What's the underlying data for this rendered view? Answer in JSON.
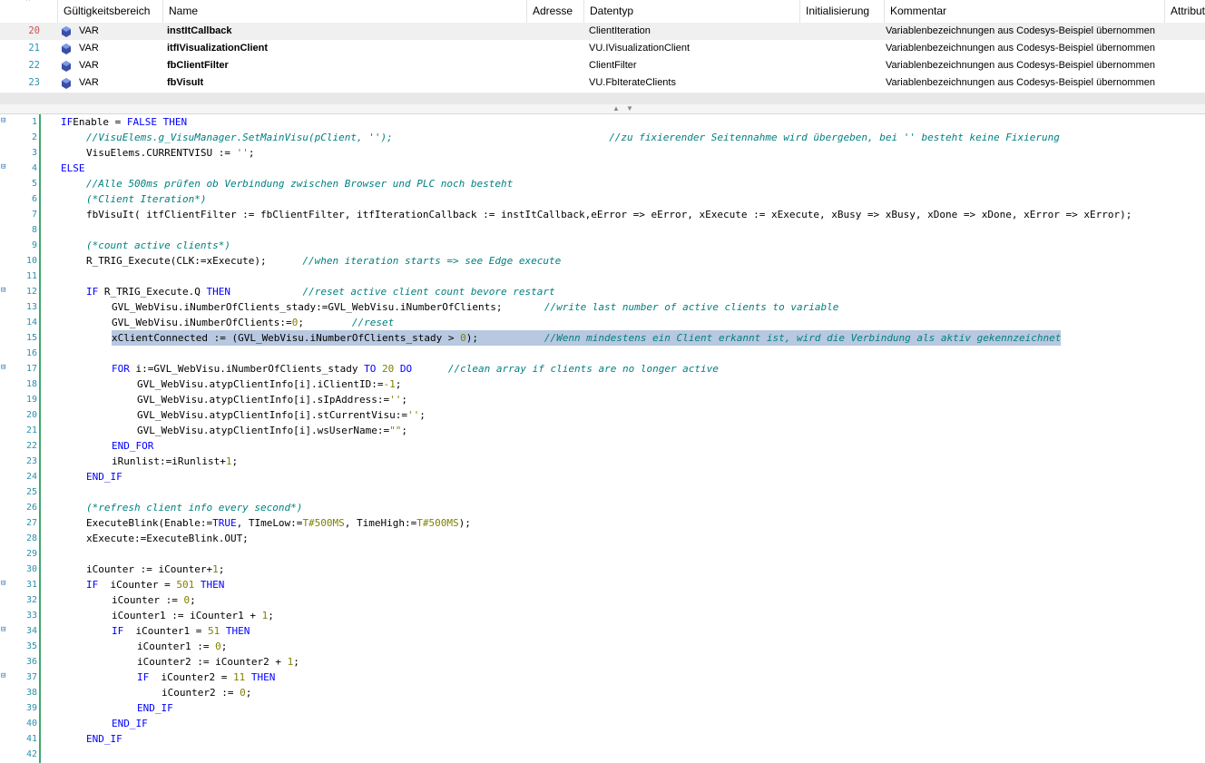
{
  "declaration": {
    "columns": [
      "Gültigkeitsbereich",
      "Name",
      "Adresse",
      "Datentyp",
      "Initialisierung",
      "Kommentar",
      "Attribut"
    ],
    "rows": [
      {
        "num": "20",
        "scope": "VAR",
        "name": "instItCallback",
        "address": "",
        "type": "ClientIteration",
        "init": "",
        "comment": "Variablenbezeichnungen aus Codesys-Beispiel übernommen",
        "selected": true
      },
      {
        "num": "21",
        "scope": "VAR",
        "name": "itfIVisualizationClient",
        "address": "",
        "type": "VU.IVisualizationClient",
        "init": "",
        "comment": "Variablenbezeichnungen aus Codesys-Beispiel übernommen",
        "selected": false
      },
      {
        "num": "22",
        "scope": "VAR",
        "name": "fbClientFilter",
        "address": "",
        "type": "ClientFilter",
        "init": "",
        "comment": "Variablenbezeichnungen aus Codesys-Beispiel übernommen",
        "selected": false
      },
      {
        "num": "23",
        "scope": "VAR",
        "name": "fbVisuIt",
        "address": "",
        "type": "VU.FbIterateClients",
        "init": "",
        "comment": "Variablenbezeichnungen aus Codesys-Beispiel übernommen",
        "selected": false
      }
    ]
  },
  "code": {
    "lines": [
      {
        "num": "1",
        "indent": 0,
        "fold": true,
        "segs": [
          [
            "k",
            "IF"
          ],
          [
            "",
            "Enable = "
          ],
          [
            "k",
            "FALSE"
          ],
          [
            "",
            " "
          ],
          [
            "k",
            "THEN"
          ]
        ]
      },
      {
        "num": "2",
        "indent": 1,
        "segs": [
          [
            "c",
            "//VisuElems.g_VisuManager.SetMainVisu(pClient, '');"
          ],
          [
            "",
            "                                    "
          ],
          [
            "c",
            "//zu fixierender Seitennahme wird übergeben, bei '' besteht keine Fixierung"
          ]
        ]
      },
      {
        "num": "3",
        "indent": 1,
        "segs": [
          [
            "",
            "VisuElems.CURRENTVISU := "
          ],
          [
            "n",
            "''"
          ],
          [
            "",
            ";"
          ]
        ]
      },
      {
        "num": "4",
        "indent": 0,
        "fold": true,
        "segs": [
          [
            "k",
            "ELSE"
          ]
        ]
      },
      {
        "num": "5",
        "indent": 1,
        "segs": [
          [
            "c",
            "//Alle 500ms prüfen ob Verbindung zwischen Browser und PLC noch besteht"
          ]
        ]
      },
      {
        "num": "6",
        "indent": 1,
        "segs": [
          [
            "c",
            "(*Client Iteration*)"
          ]
        ]
      },
      {
        "num": "7",
        "indent": 1,
        "segs": [
          [
            "",
            "fbVisuIt( itfClientFilter := fbClientFilter, itfIterationCallback := instItCallback,eError => eError, xExecute := xExecute, xBusy => xBusy, xDone => xDone, xError => xError);"
          ]
        ]
      },
      {
        "num": "8",
        "indent": 0,
        "segs": []
      },
      {
        "num": "9",
        "indent": 1,
        "segs": [
          [
            "c",
            "(*count active clients*)"
          ]
        ]
      },
      {
        "num": "10",
        "indent": 1,
        "segs": [
          [
            "",
            "R_TRIG_Execute(CLK:=xExecute);      "
          ],
          [
            "c",
            "//when iteration starts => see Edge execute"
          ]
        ]
      },
      {
        "num": "11",
        "indent": 0,
        "segs": []
      },
      {
        "num": "12",
        "indent": 1,
        "fold": true,
        "segs": [
          [
            "k",
            "IF"
          ],
          [
            "",
            " R_TRIG_Execute.Q "
          ],
          [
            "k",
            "THEN"
          ],
          [
            "",
            "            "
          ],
          [
            "c",
            "//reset active client count bevore restart"
          ]
        ]
      },
      {
        "num": "13",
        "indent": 2,
        "segs": [
          [
            "",
            "GVL_WebVisu.iNumberOfClients_stady:=GVL_WebVisu.iNumberOfClients;       "
          ],
          [
            "c",
            "//write last number of active clients to variable"
          ]
        ]
      },
      {
        "num": "14",
        "indent": 2,
        "segs": [
          [
            "",
            "GVL_WebVisu.iNumberOfClients:="
          ],
          [
            "n",
            "0"
          ],
          [
            "",
            ";        "
          ],
          [
            "c",
            "//reset"
          ]
        ]
      },
      {
        "num": "15",
        "indent": 2,
        "highlight": true,
        "segs": [
          [
            "",
            "xClientConnected := (GVL_WebVisu.iNumberOfClients_stady > "
          ],
          [
            "n",
            "0"
          ],
          [
            "",
            ");           "
          ],
          [
            "c",
            "//Wenn mindestens ein Client erkannt ist, wird die Verbindung als aktiv gekennzeichnet"
          ]
        ]
      },
      {
        "num": "16",
        "indent": 0,
        "segs": []
      },
      {
        "num": "17",
        "indent": 2,
        "fold": true,
        "segs": [
          [
            "k",
            "FOR"
          ],
          [
            "",
            " i:=GVL_WebVisu.iNumberOfClients_stady "
          ],
          [
            "k",
            "TO"
          ],
          [
            "",
            " "
          ],
          [
            "n",
            "20"
          ],
          [
            "",
            " "
          ],
          [
            "k",
            "DO"
          ],
          [
            "",
            "      "
          ],
          [
            "c",
            "//clean array if clients are no longer active"
          ]
        ]
      },
      {
        "num": "18",
        "indent": 3,
        "segs": [
          [
            "",
            "GVL_WebVisu.atypClientInfo[i].iClientID:="
          ],
          [
            "n",
            "-1"
          ],
          [
            "",
            ";"
          ]
        ]
      },
      {
        "num": "19",
        "indent": 3,
        "segs": [
          [
            "",
            "GVL_WebVisu.atypClientInfo[i].sIpAddress:="
          ],
          [
            "n",
            "''"
          ],
          [
            "",
            ";"
          ]
        ]
      },
      {
        "num": "20",
        "indent": 3,
        "segs": [
          [
            "",
            "GVL_WebVisu.atypClientInfo[i].stCurrentVisu:="
          ],
          [
            "n",
            "''"
          ],
          [
            "",
            ";"
          ]
        ]
      },
      {
        "num": "21",
        "indent": 3,
        "segs": [
          [
            "",
            "GVL_WebVisu.atypClientInfo[i].wsUserName:="
          ],
          [
            "n",
            "\"\""
          ],
          [
            "",
            ";"
          ]
        ]
      },
      {
        "num": "22",
        "indent": 2,
        "segs": [
          [
            "k",
            "END_FOR"
          ]
        ]
      },
      {
        "num": "23",
        "indent": 2,
        "segs": [
          [
            "",
            "iRunlist:=iRunlist+"
          ],
          [
            "n",
            "1"
          ],
          [
            "",
            ";"
          ]
        ]
      },
      {
        "num": "24",
        "indent": 1,
        "segs": [
          [
            "k",
            "END_IF"
          ]
        ]
      },
      {
        "num": "25",
        "indent": 0,
        "segs": []
      },
      {
        "num": "26",
        "indent": 1,
        "segs": [
          [
            "c",
            "(*refresh client info every second*)"
          ]
        ]
      },
      {
        "num": "27",
        "indent": 1,
        "segs": [
          [
            "",
            "ExecuteBlink(Enable:="
          ],
          [
            "k",
            "TRUE"
          ],
          [
            "",
            ", TImeLow:="
          ],
          [
            "n",
            "T#500MS"
          ],
          [
            "",
            ", TimeHigh:="
          ],
          [
            "n",
            "T#500MS"
          ],
          [
            "",
            ");"
          ]
        ]
      },
      {
        "num": "28",
        "indent": 1,
        "segs": [
          [
            "",
            "xExecute:=ExecuteBlink.OUT;"
          ]
        ]
      },
      {
        "num": "29",
        "indent": 0,
        "segs": []
      },
      {
        "num": "30",
        "indent": 1,
        "segs": [
          [
            "",
            "iCounter := iCounter+"
          ],
          [
            "n",
            "1"
          ],
          [
            "",
            ";"
          ]
        ]
      },
      {
        "num": "31",
        "indent": 1,
        "fold": true,
        "segs": [
          [
            "k",
            "IF"
          ],
          [
            "",
            "  iCounter = "
          ],
          [
            "n",
            "501"
          ],
          [
            "",
            " "
          ],
          [
            "k",
            "THEN"
          ]
        ]
      },
      {
        "num": "32",
        "indent": 2,
        "segs": [
          [
            "",
            "iCounter := "
          ],
          [
            "n",
            "0"
          ],
          [
            "",
            ";"
          ]
        ]
      },
      {
        "num": "33",
        "indent": 2,
        "segs": [
          [
            "",
            "iCounter1 := iCounter1 + "
          ],
          [
            "n",
            "1"
          ],
          [
            "",
            ";"
          ]
        ]
      },
      {
        "num": "34",
        "indent": 2,
        "fold": true,
        "segs": [
          [
            "k",
            "IF"
          ],
          [
            "",
            "  iCounter1 = "
          ],
          [
            "n",
            "51"
          ],
          [
            "",
            " "
          ],
          [
            "k",
            "THEN"
          ]
        ]
      },
      {
        "num": "35",
        "indent": 3,
        "segs": [
          [
            "",
            "iCounter1 := "
          ],
          [
            "n",
            "0"
          ],
          [
            "",
            ";"
          ]
        ]
      },
      {
        "num": "36",
        "indent": 3,
        "segs": [
          [
            "",
            "iCounter2 := iCounter2 + "
          ],
          [
            "n",
            "1"
          ],
          [
            "",
            ";"
          ]
        ]
      },
      {
        "num": "37",
        "indent": 3,
        "fold": true,
        "segs": [
          [
            "k",
            "IF"
          ],
          [
            "",
            "  iCounter2 = "
          ],
          [
            "n",
            "11"
          ],
          [
            "",
            " "
          ],
          [
            "k",
            "THEN"
          ]
        ]
      },
      {
        "num": "38",
        "indent": 4,
        "segs": [
          [
            "",
            "iCounter2 := "
          ],
          [
            "n",
            "0"
          ],
          [
            "",
            ";"
          ]
        ]
      },
      {
        "num": "39",
        "indent": 3,
        "segs": [
          [
            "k",
            "END_IF"
          ]
        ]
      },
      {
        "num": "40",
        "indent": 2,
        "segs": [
          [
            "k",
            "END_IF"
          ]
        ]
      },
      {
        "num": "41",
        "indent": 1,
        "segs": [
          [
            "k",
            "END_IF"
          ]
        ]
      },
      {
        "num": "42",
        "indent": 0,
        "segs": []
      }
    ]
  },
  "colors": {
    "keyword": "#0000ff",
    "comment": "#008080",
    "number": "#808000",
    "line_number": "#2b91af",
    "change_bar": "#3ea86b",
    "selection": "#b7c8e0"
  },
  "icons": {
    "var_icon": "variable-icon",
    "fold_icon": "fold-toggle-icon",
    "sort_icon": "sort-ascending-icon"
  }
}
